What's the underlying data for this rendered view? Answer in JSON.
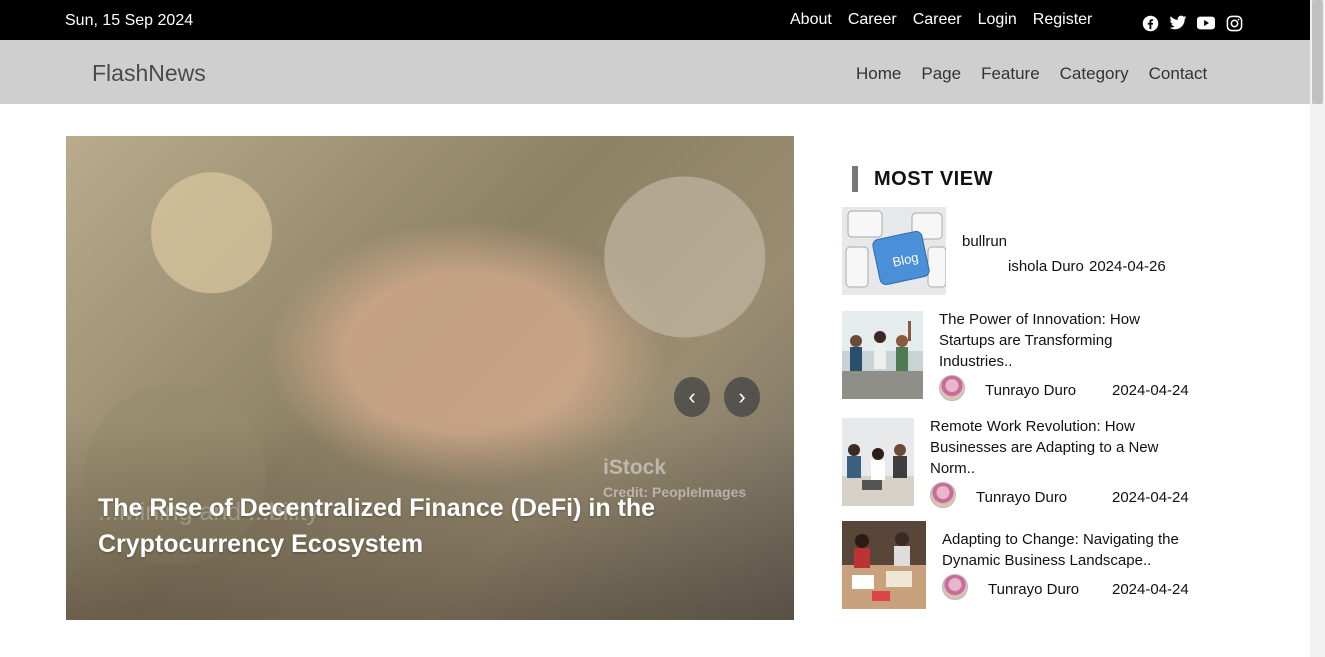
{
  "topbar": {
    "date": "Sun, 15 Sep 2024",
    "links": [
      "About",
      "Career",
      "Career",
      "Login",
      "Register"
    ],
    "social_icons": [
      "facebook-icon",
      "twitter-icon",
      "youtube-icon",
      "instagram-icon"
    ]
  },
  "navbar": {
    "brand": "FlashNews",
    "items": [
      "Home",
      "Page",
      "Feature",
      "Category",
      "Contact"
    ]
  },
  "hero": {
    "caption": "The Rise of Decentralized Finance (DeFi) in the Cryptocurrency Ecosystem",
    "ghost_caption": "...Mining and ...bility",
    "watermark": "iStock",
    "credit": "Credit: PeopleImages",
    "prev": "‹",
    "next": "›"
  },
  "sidebar": {
    "heading": "MOST VIEW",
    "items": [
      {
        "title": "bullrun",
        "author": "ishola Duro",
        "date": "2024-04-26"
      },
      {
        "title": "The Power of Innovation: How Startups are Transforming Industries..",
        "author": "Tunrayo Duro",
        "date": "2024-04-24"
      },
      {
        "title": "Remote Work Revolution: How Businesses are Adapting to a New Norm..",
        "author": "Tunrayo Duro",
        "date": "2024-04-24"
      },
      {
        "title": "Adapting to Change: Navigating the Dynamic Business Landscape..",
        "author": "Tunrayo Duro",
        "date": "2024-04-24"
      }
    ]
  },
  "colors": {
    "topbar": "#000000",
    "navbar": "#cfcfcf",
    "accent_bar": "#777777"
  }
}
